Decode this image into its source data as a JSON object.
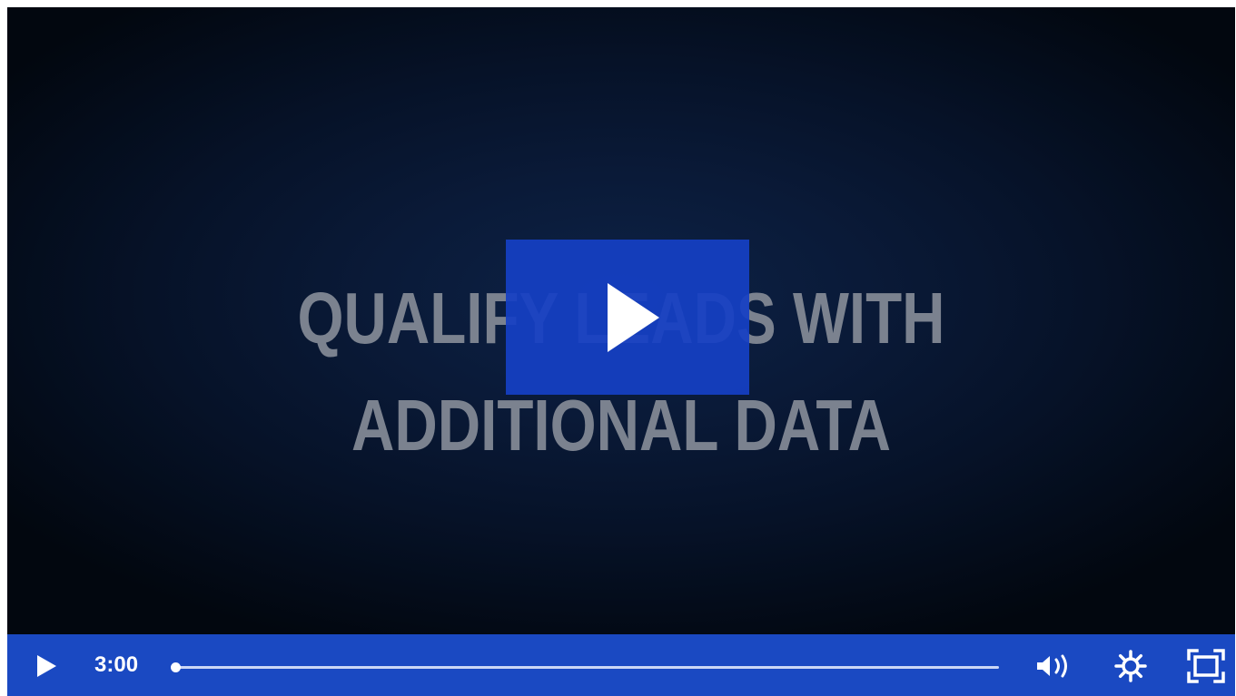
{
  "video": {
    "title_line_1": "QUALIFY LEADS WITH",
    "title_line_2": "ADDITIONAL DATA"
  },
  "controls": {
    "time": "3:00",
    "progress": 0,
    "accent_color": "#1a49c2"
  },
  "icons": {
    "big_play": "play-icon",
    "small_play": "play-icon",
    "volume": "volume-icon",
    "settings": "gear-icon",
    "fullscreen": "fullscreen-icon"
  }
}
